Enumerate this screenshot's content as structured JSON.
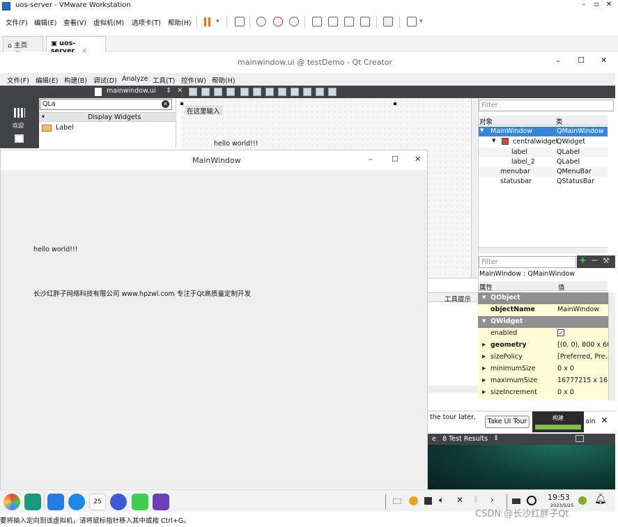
{
  "vmware": {
    "title": "uos-server - VMware Workstation",
    "menu": [
      "文件(F)",
      "编辑(E)",
      "查看(V)",
      "虚拟机(M)",
      "选项卡(T)",
      "帮助(H)"
    ],
    "tabs": [
      {
        "label": "主页"
      },
      {
        "label": "uos-server"
      }
    ],
    "status_text": "要将输入定向到该虚拟机，请将鼠标指针移入其中或按 Ctrl+G。"
  },
  "qtcreator": {
    "title": "mainwindow.ui @ testDemo - Qt Creator",
    "menu": [
      "文件(F)",
      "编辑(E)",
      "构建(B)",
      "调试(D)",
      "Analyze",
      "工具(T)",
      "控件(W)",
      "帮助(H)"
    ],
    "mode_label": "欢迎",
    "open_file": "mainwindow.ui",
    "widget_search": "QLa",
    "widget_category": "Display Widgets",
    "widget_item": "Label",
    "canvas_input": "在这里输入",
    "canvas_hello": "hello world!!!",
    "object_filter_placeholder": "Filter",
    "object_headers": [
      "对象",
      "类"
    ],
    "objects": [
      {
        "name": "MainWindow",
        "cls": "QMainWindow"
      },
      {
        "name": "centralwidget",
        "cls": "QWidget"
      },
      {
        "name": "label",
        "cls": "QLabel"
      },
      {
        "name": "label_2",
        "cls": "QLabel"
      },
      {
        "name": "menubar",
        "cls": "QMenuBar"
      },
      {
        "name": "statusbar",
        "cls": "QStatusBar"
      }
    ],
    "prop_filter_placeholder": "Filter",
    "prop_context": "MainWindow : QMainWindow",
    "prop_headers": [
      "属性",
      "值"
    ],
    "props": [
      {
        "name": "QObject",
        "value": ""
      },
      {
        "name": "objectName",
        "value": "MainWindow"
      },
      {
        "name": "QWidget",
        "value": ""
      },
      {
        "name": "enabled",
        "value": "✓"
      },
      {
        "name": "geometry",
        "value": "[(0, 0), 800 x 600]"
      },
      {
        "name": "sizePolicy",
        "value": "[Preferred, Pre..."
      },
      {
        "name": "minimumSize",
        "value": "0 x 0"
      },
      {
        "name": "maximumSize",
        "value": "16777215 x 16..."
      },
      {
        "name": "sizeIncrement",
        "value": "0 x 0"
      }
    ],
    "tooltip_col": "工具提示",
    "tour_text": "the tour later,",
    "tour_button": "Take UI Tour",
    "build_label": "构建",
    "tour_fragment": "ain",
    "tests_tab": "8  Test Results"
  },
  "runwindow": {
    "title": "MainWindow",
    "hello": "hello world!!!",
    "company": "长沙红胖子网络科技有限公司 www.hpzwl.com 专注于Qt高质量定制开发"
  },
  "taskbar": {
    "time": "19:53",
    "date": "2023/5/25",
    "calendar_day": "25"
  },
  "watermark": "CSDN @长沙红胖子Qt"
}
